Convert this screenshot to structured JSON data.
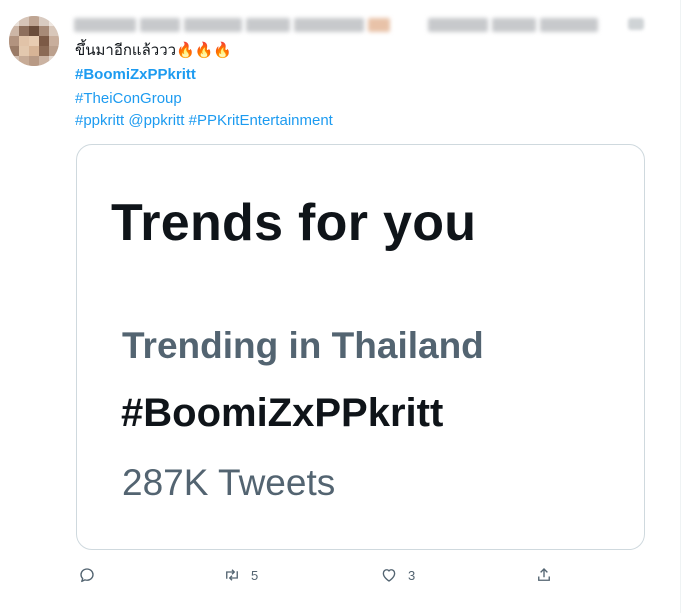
{
  "tweet": {
    "text_line1": "ขึ้นมาอีกแล้ววว",
    "emoji_fire": "🔥",
    "hashtag_main": "#BoomiZxPPkritt",
    "hashtag_group": "#TheiConGroup",
    "tags_line": "#ppkritt @ppkritt #PPKritEntertainment"
  },
  "card": {
    "title": "Trends for you",
    "trend_context": "Trending in Thailand",
    "trend_name": "#BoomiZxPPkritt",
    "trend_count": "287K Tweets"
  },
  "actions": {
    "reply_icon": "reply-icon",
    "retweet_icon": "retweet-icon",
    "retweet_count": "5",
    "like_icon": "like-icon",
    "like_count": "3",
    "share_icon": "share-icon"
  },
  "colors": {
    "link": "#1d9bf0",
    "text": "#0f1419",
    "muted": "#536471",
    "border": "#cfd9de"
  }
}
